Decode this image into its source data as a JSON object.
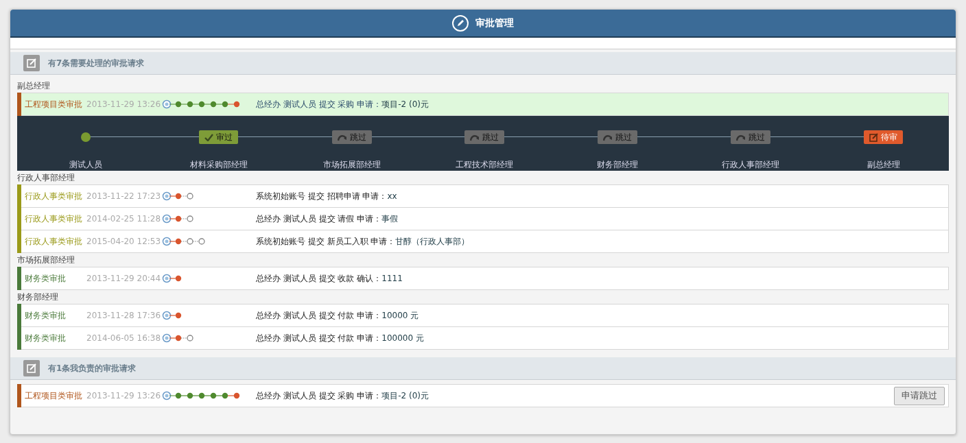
{
  "header": {
    "title": "审批管理"
  },
  "sections": [
    {
      "title": "有7条需要处理的审批请求",
      "groups": [
        {
          "label": "副总经理",
          "rows": [
            {
              "category": "工程项目类审批",
              "color": "#b0561c",
              "time": "2013-11-29 13:26",
              "steps": [
                {
                  "kind": "start"
                },
                {
                  "kind": "done"
                },
                {
                  "kind": "done"
                },
                {
                  "kind": "done"
                },
                {
                  "kind": "done"
                },
                {
                  "kind": "done"
                },
                {
                  "kind": "current"
                }
              ],
              "text": "总经办 测试人员 提交 采购 申请：",
              "value": "项目-2 (0)元",
              "selected": true,
              "flow": [
                {
                  "name": "测试人员",
                  "kind": "start"
                },
                {
                  "name": "材料采购部经理",
                  "kind": "approved",
                  "label": "审过"
                },
                {
                  "name": "市场拓展部经理",
                  "kind": "skipped",
                  "label": "跳过"
                },
                {
                  "name": "工程技术部经理",
                  "kind": "skipped",
                  "label": "跳过"
                },
                {
                  "name": "财务部经理",
                  "kind": "skipped",
                  "label": "跳过"
                },
                {
                  "name": "行政人事部经理",
                  "kind": "skipped",
                  "label": "跳过"
                },
                {
                  "name": "副总经理",
                  "kind": "pending",
                  "label": "待审"
                }
              ]
            }
          ]
        },
        {
          "label": "行政人事部经理",
          "rows": [
            {
              "category": "行政人事类审批",
              "color": "#9a9a1a",
              "time": "2013-11-22 17:23",
              "steps": [
                {
                  "kind": "start"
                },
                {
                  "kind": "current"
                },
                {
                  "kind": "pending"
                }
              ],
              "text": "系统初始账号 提交 招聘申请 申请：",
              "value": "xx",
              "selected": false
            },
            {
              "category": "行政人事类审批",
              "color": "#9a9a1a",
              "time": "2014-02-25 11:28",
              "steps": [
                {
                  "kind": "start"
                },
                {
                  "kind": "current"
                },
                {
                  "kind": "pending"
                }
              ],
              "text": "总经办 测试人员 提交 请假 申请：",
              "value": "事假",
              "selected": false
            },
            {
              "category": "行政人事类审批",
              "color": "#9a9a1a",
              "time": "2015-04-20 12:53",
              "steps": [
                {
                  "kind": "start"
                },
                {
                  "kind": "current"
                },
                {
                  "kind": "pending"
                },
                {
                  "kind": "pending"
                }
              ],
              "text": "系统初始账号 提交 新员工入职 申请：",
              "value": "甘醇（行政人事部）",
              "selected": false
            }
          ]
        },
        {
          "label": "市场拓展部经理",
          "rows": [
            {
              "category": "财务类审批",
              "color": "#4a7a3a",
              "time": "2013-11-29 20:44",
              "steps": [
                {
                  "kind": "start"
                },
                {
                  "kind": "current"
                }
              ],
              "text": "总经办 测试人员 提交 收款 确认：",
              "value": "1111",
              "selected": false
            }
          ]
        },
        {
          "label": "财务部经理",
          "rows": [
            {
              "category": "财务类审批",
              "color": "#4a7a3a",
              "time": "2013-11-28 17:36",
              "steps": [
                {
                  "kind": "start"
                },
                {
                  "kind": "current"
                }
              ],
              "text": "总经办 测试人员 提交 付款 申请：",
              "value": "10000 元",
              "selected": false
            },
            {
              "category": "财务类审批",
              "color": "#4a7a3a",
              "time": "2014-06-05 16:38",
              "steps": [
                {
                  "kind": "start"
                },
                {
                  "kind": "current"
                },
                {
                  "kind": "pending"
                }
              ],
              "text": "总经办 测试人员 提交 付款 申请：",
              "value": "100000 元",
              "selected": false
            }
          ]
        }
      ]
    },
    {
      "title": "有1条我负责的审批请求",
      "groups": [
        {
          "rows": [
            {
              "category": "工程项目类审批",
              "color": "#b0561c",
              "time": "2013-11-29 13:26",
              "steps": [
                {
                  "kind": "start"
                },
                {
                  "kind": "done"
                },
                {
                  "kind": "done"
                },
                {
                  "kind": "done"
                },
                {
                  "kind": "done"
                },
                {
                  "kind": "done"
                },
                {
                  "kind": "current"
                }
              ],
              "text": "总经办 测试人员 提交 采购 申请：",
              "value": "项目-2 (0)元",
              "selected": false,
              "action": "申请跳过"
            }
          ]
        }
      ]
    }
  ]
}
